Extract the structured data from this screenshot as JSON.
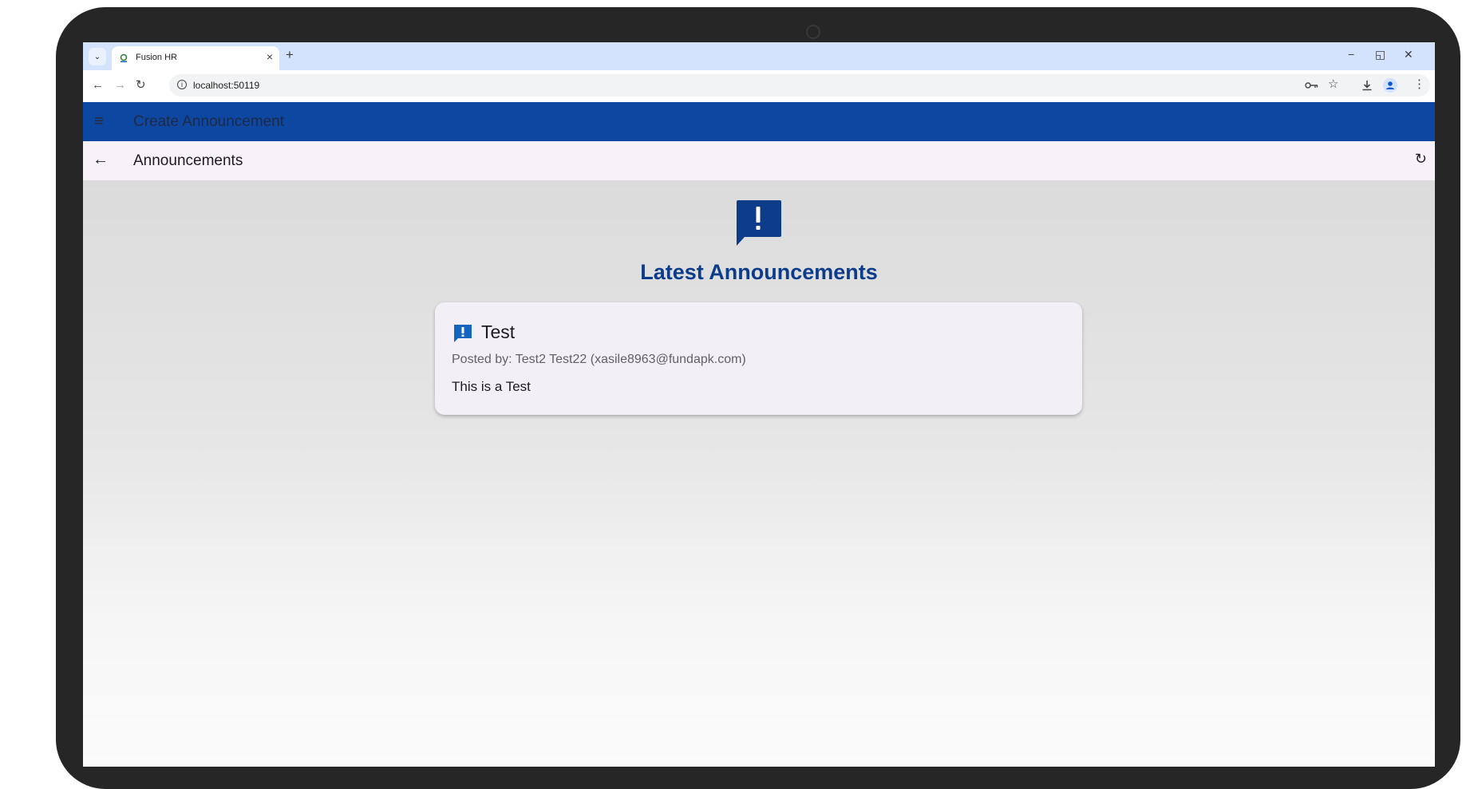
{
  "browser": {
    "tab_title": "Fusion HR",
    "tab_close": "×",
    "new_tab": "+",
    "url": "localhost:50119",
    "window_controls": {
      "minimize": "−",
      "restore": "◱",
      "close": "✕"
    },
    "nav": {
      "back": "←",
      "forward": "→",
      "reload": "↻"
    },
    "icons": [
      "password-key-icon",
      "bookmark-star-icon",
      "download-icon",
      "profile-icon",
      "more-menu-icon"
    ]
  },
  "appbar": {
    "title": "Create Announcement",
    "menu_glyph": "≡"
  },
  "subbar": {
    "title": "Announcements",
    "back_glyph": "←",
    "refresh_glyph": "↻"
  },
  "content": {
    "heading": "Latest Announcements",
    "announcements": [
      {
        "title": "Test",
        "posted_by": "Posted by: Test2 Test22 (xasile8963@fundapk.com)",
        "body": "This is a Test"
      }
    ]
  },
  "colors": {
    "app_bar": "#0d47a1",
    "heading": "#0d3c8a",
    "card": "#f3eff7",
    "sub_bar": "#f7f2fa"
  }
}
